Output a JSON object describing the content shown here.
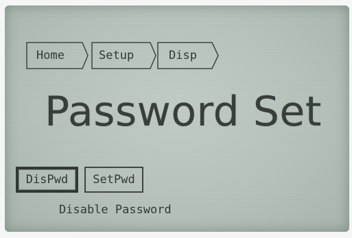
{
  "breadcrumb": {
    "items": [
      {
        "label": "Home"
      },
      {
        "label": "Setup"
      },
      {
        "label": "Disp"
      }
    ]
  },
  "screen": {
    "title": "Password Set"
  },
  "softkeys": [
    {
      "label": "DisPwd",
      "selected": true
    },
    {
      "label": "SetPwd",
      "selected": false
    }
  ],
  "hint": "Disable Password"
}
